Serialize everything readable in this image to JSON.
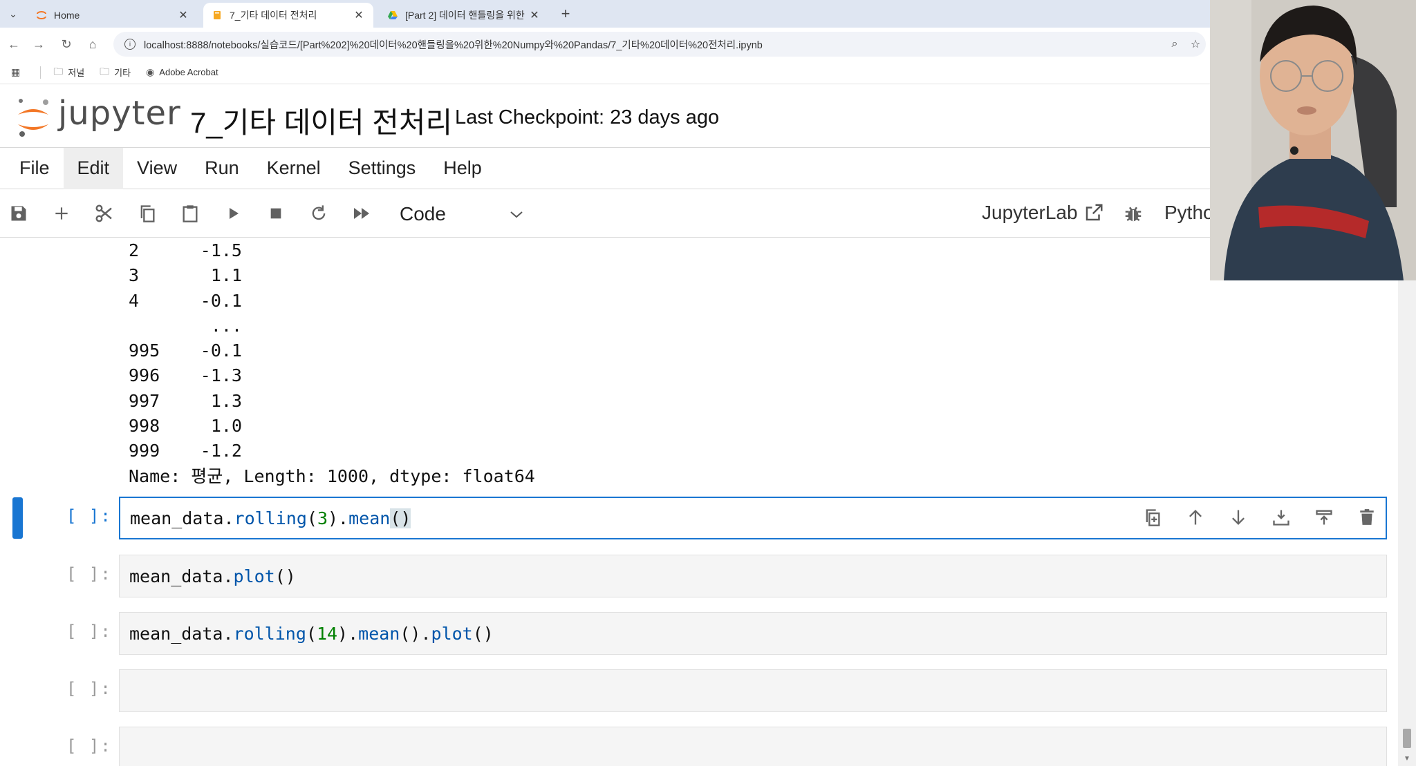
{
  "browser": {
    "tabs": [
      {
        "title": "Home",
        "active": false
      },
      {
        "title": "7_기타 데이터 전처리",
        "active": true
      },
      {
        "title": "[Part 2] 데이터 핸들링을 위한",
        "active": false
      }
    ],
    "url": "localhost:8888/notebooks/실습코드/[Part%202]%20데이터%20핸들링을%20위한%20Numpy와%20Pandas/7_기타%20데이터%20전처리.ipynb",
    "bookmarks": [
      "저널",
      "기타",
      "Adobe Acrobat"
    ]
  },
  "jupyter": {
    "wordmark": "jupyter",
    "notebook_title": "7_기타 데이터 전처리",
    "checkpoint": "Last Checkpoint: 23 days ago",
    "menu": [
      "File",
      "Edit",
      "View",
      "Run",
      "Kernel",
      "Settings",
      "Help"
    ],
    "cell_type": "Code",
    "jupyterlab_label": "JupyterLab",
    "kernel_label": "Python"
  },
  "output": {
    "rows": [
      {
        "idx": "2",
        "val": "-1.5"
      },
      {
        "idx": "3",
        "val": "1.1"
      },
      {
        "idx": "4",
        "val": "-0.1"
      },
      {
        "idx": "",
        "val": "..."
      },
      {
        "idx": "995",
        "val": "-0.1"
      },
      {
        "idx": "996",
        "val": "-1.3"
      },
      {
        "idx": "997",
        "val": "1.3"
      },
      {
        "idx": "998",
        "val": "1.0"
      },
      {
        "idx": "999",
        "val": "-1.2"
      }
    ],
    "footer": "Name: 평균, Length: 1000, dtype: float64"
  },
  "cells": [
    {
      "prompt": "[ ]:",
      "code": "mean_data.rolling(3).mean()"
    },
    {
      "prompt": "[ ]:",
      "code": "mean_data.plot()"
    },
    {
      "prompt": "[ ]:",
      "code": "mean_data.rolling(14).mean().plot()"
    },
    {
      "prompt": "[ ]:",
      "code": ""
    },
    {
      "prompt": "[ ]:",
      "code": ""
    }
  ],
  "colors": {
    "accent": "#1976d2",
    "jupyter_orange": "#f37726"
  }
}
